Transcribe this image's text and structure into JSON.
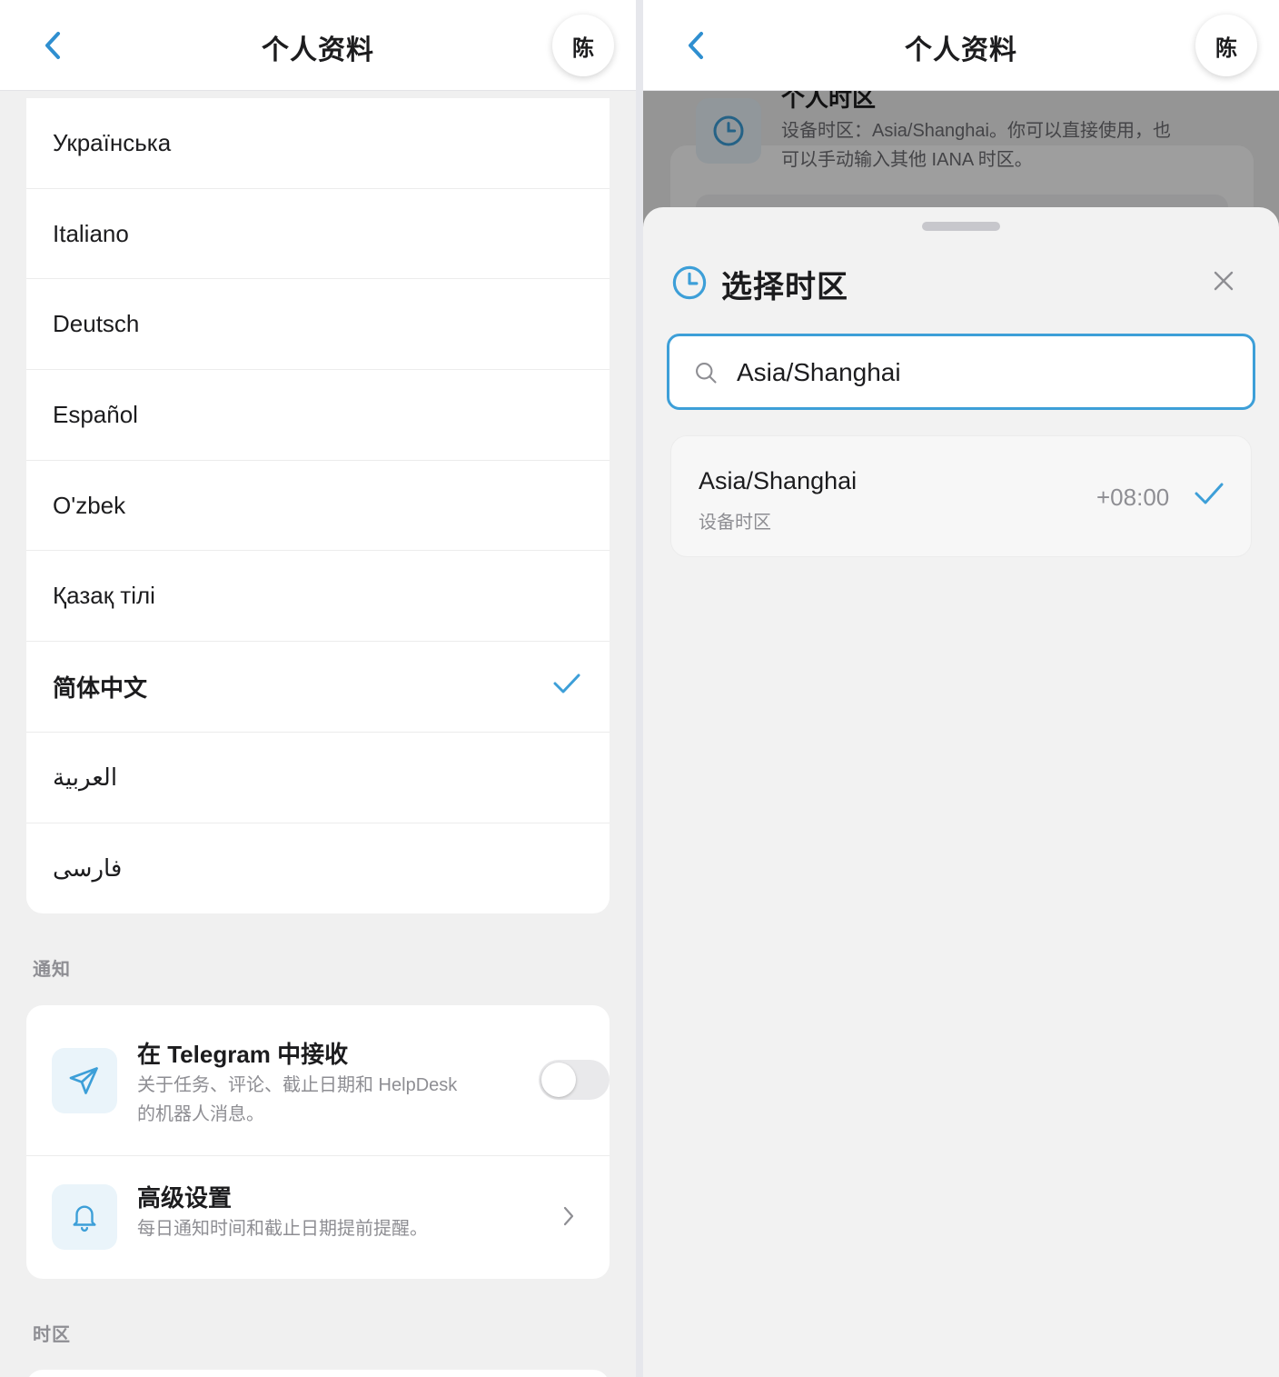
{
  "left": {
    "header": {
      "title": "个人资料",
      "avatar_text": "陈"
    },
    "languages": [
      {
        "label": "Українська",
        "selected": false
      },
      {
        "label": "Italiano",
        "selected": false
      },
      {
        "label": "Deutsch",
        "selected": false
      },
      {
        "label": "Español",
        "selected": false
      },
      {
        "label": "O'zbek",
        "selected": false
      },
      {
        "label": "Қазақ тілі",
        "selected": false
      },
      {
        "label": "简体中文",
        "selected": true
      },
      {
        "label": "العربية",
        "selected": false
      },
      {
        "label": "فارسی",
        "selected": false
      }
    ],
    "notifications": {
      "section_label": "通知",
      "telegram": {
        "title": "在 Telegram 中接收",
        "desc_line1": "关于任务、评论、截止日期和 HelpDesk",
        "desc_line2": "的机器人消息。",
        "enabled": false
      },
      "advanced": {
        "title": "高级设置",
        "desc": "每日通知时间和截止日期提前提醒。"
      }
    },
    "timezone_section_label": "时区"
  },
  "right": {
    "header": {
      "title": "个人资料",
      "avatar_text": "陈"
    },
    "background_card": {
      "title": "个人时区",
      "desc_line1": "设备时区：Asia/Shanghai。你可以直接使用，也",
      "desc_line2": "可以手动输入其他 IANA 时区。"
    },
    "sheet": {
      "title": "选择时区",
      "search_value": "Asia/Shanghai",
      "results": [
        {
          "name": "Asia/Shanghai",
          "subtitle": "设备时区",
          "offset": "+08:00",
          "selected": true
        }
      ]
    }
  },
  "colors": {
    "accent": "#3d9fd8",
    "icon_bg": "#eaf4fa",
    "muted_text": "#8e8e93"
  }
}
